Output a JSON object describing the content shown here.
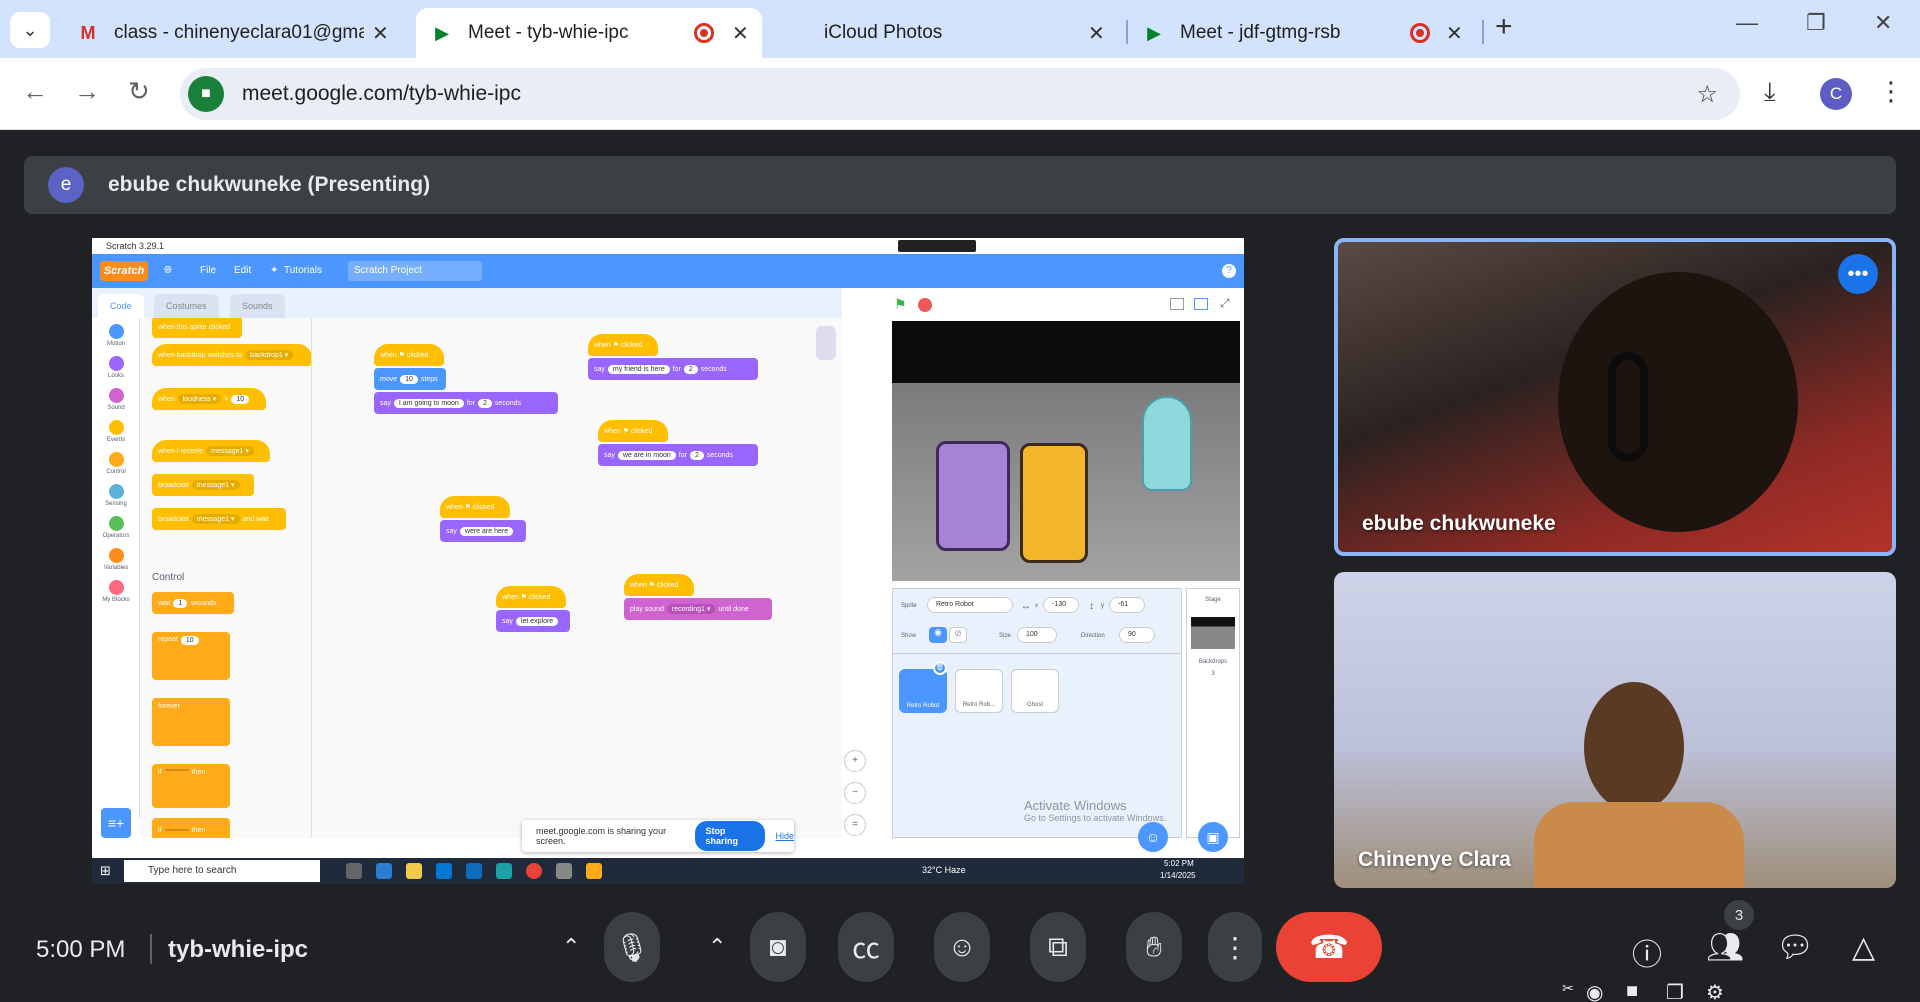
{
  "browser": {
    "tabs": [
      {
        "label": "class - chinenyeclara01@gmail.",
        "icon": "gmail-icon"
      },
      {
        "label": "Meet - tyb-whie-ipc",
        "icon": "meet-icon",
        "recording": true
      },
      {
        "label": "iCloud Photos",
        "icon": "apple-icon"
      },
      {
        "label": "Meet - jdf-gtmg-rsb",
        "icon": "meet-icon",
        "recording": true
      }
    ],
    "url": "meet.google.com/tyb-whie-ipc",
    "profile_initial": "C"
  },
  "presenting": {
    "avatar_initial": "e",
    "label": "ebube chukwuneke (Presenting)"
  },
  "scratch": {
    "window_title": "Scratch 3.29.1",
    "logo": "Scratch",
    "menu": {
      "file": "File",
      "edit": "Edit",
      "tutorials": "Tutorials"
    },
    "project_title": "Scratch Project",
    "tabs": {
      "code": "Code",
      "costumes": "Costumes",
      "sounds": "Sounds"
    },
    "categories": [
      {
        "label": "Motion",
        "color": "#4c97ff"
      },
      {
        "label": "Looks",
        "color": "#9966ff"
      },
      {
        "label": "Sound",
        "color": "#cf63cf"
      },
      {
        "label": "Events",
        "color": "#ffbf00"
      },
      {
        "label": "Control",
        "color": "#ffab19"
      },
      {
        "label": "Sensing",
        "color": "#5cb1d6"
      },
      {
        "label": "Operators",
        "color": "#59c059"
      },
      {
        "label": "Variables",
        "color": "#ff8c1a"
      },
      {
        "label": "My Blocks",
        "color": "#ff6680"
      }
    ],
    "palette": {
      "b1": "when this sprite clicked",
      "b2a": "when backdrop switches to",
      "b2b": "backdrop1 ▾",
      "b3a": "when",
      "b3b": "loudness ▾",
      "b3c": ">",
      "b3d": "10",
      "b4a": "when I receive",
      "b4b": "message1 ▾",
      "b5a": "broadcast",
      "b5b": "message1 ▾",
      "b6a": "broadcast",
      "b6b": "message1 ▾",
      "b6c": "and wait",
      "control_label": "Control",
      "c1a": "wait",
      "c1b": "1",
      "c1c": "seconds",
      "c2a": "repeat",
      "c2b": "10",
      "c3": "forever",
      "c4a": "if",
      "c4b": "then",
      "c5a": "if",
      "c5b": "then"
    },
    "scripts": {
      "s1_hat": "when ⚑ clicked",
      "s1_move": "move",
      "s1_steps_val": "10",
      "s1_steps": "steps",
      "s1_say": "say",
      "s1_say_text": "I am going to moon",
      "s1_for": "for",
      "s1_secs_val": "2",
      "s1_secs": "seconds",
      "s2_hat": "when ⚑ clicked",
      "s2_say": "say",
      "s2_text": "my friend is here",
      "s2_for": "for",
      "s2_val": "2",
      "s2_secs": "seconds",
      "s3_hat": "when ⚑ clicked",
      "s3_say": "say",
      "s3_text": "we are in moon",
      "s3_for": "for",
      "s3_val": "2",
      "s3_secs": "seconds",
      "s4_hat": "when ⚑ clicked",
      "s4_say": "say",
      "s4_text": "were are here",
      "s5_hat": "when ⚑ clicked",
      "s5_say": "say",
      "s5_text": "let explore",
      "s6_hat": "when ⚑ clicked",
      "s6_a": "play sound",
      "s6_b": "recording1 ▾",
      "s6_c": "until done"
    },
    "sprite_info": {
      "sprite_label": "Sprite",
      "sprite_name": "Retro Robot",
      "x_label": "x",
      "x": "-130",
      "y_label": "y",
      "y": "-61",
      "show_label": "Show",
      "size_label": "Size",
      "size": "100",
      "direction_label": "Direction",
      "direction": "90"
    },
    "sprites": [
      "Retro Robot",
      "Retro Rob...",
      "Ghost"
    ],
    "stage_panel": {
      "label": "Stage",
      "backdrops_label": "Backdrops",
      "backdrops_count": "3"
    },
    "watermark_1": "Activate Windows",
    "watermark_2": "Go to Settings to activate Windows.",
    "share_notice": {
      "text": "meet.google.com is sharing your screen.",
      "stop": "Stop sharing",
      "hide": "Hide"
    },
    "taskbar": {
      "search_placeholder": "Type here to search",
      "weather": "32°C  Haze",
      "time": "5:02 PM",
      "date": "1/14/2025"
    }
  },
  "participants": [
    {
      "name": "ebube chukwuneke"
    },
    {
      "name": "Chinenye Clara"
    }
  ],
  "meeting": {
    "time": "5:00 PM",
    "code": "tyb-whie-ipc",
    "people_count": "3"
  }
}
